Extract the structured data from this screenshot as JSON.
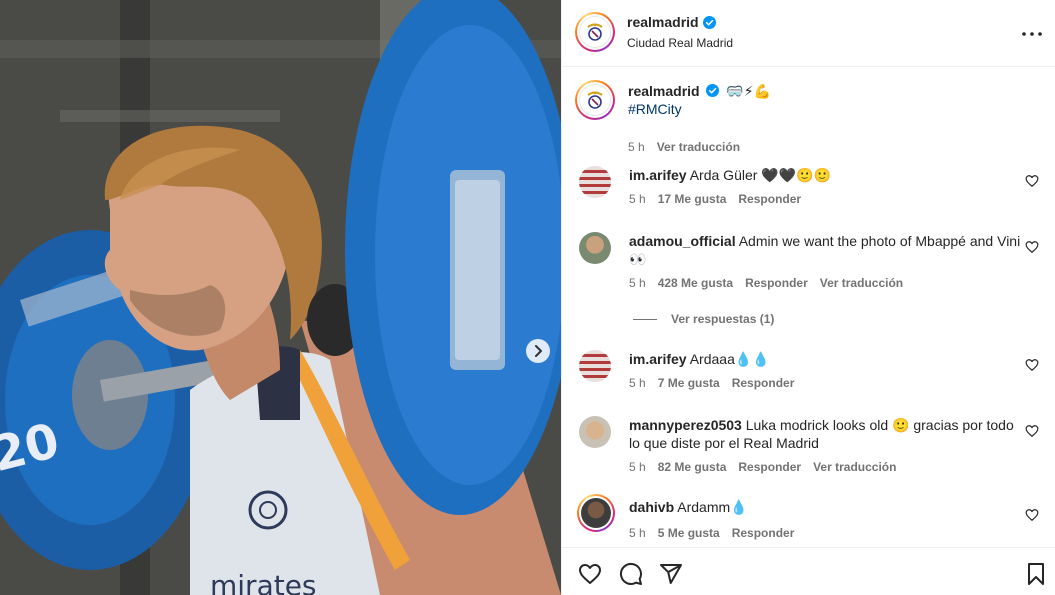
{
  "post": {
    "username": "realmadrid",
    "location": "Ciudad Real Madrid",
    "media": {
      "plate_number": "20",
      "shirt_text": "mirates"
    }
  },
  "caption": {
    "username": "realmadrid",
    "emojis": "🥽⚡💪",
    "hashtag": "#RMCity",
    "time": "5 h",
    "translate": "Ver traducción"
  },
  "comments": [
    {
      "username": "im.arifey",
      "text": "Arda Güler 🖤🖤🙂🙂",
      "time": "5 h",
      "likes": "17 Me gusta",
      "reply": "Responder",
      "translate": ""
    },
    {
      "username": "adamou_official",
      "text": "Admin we want the photo of Mbappé and Vini 👀",
      "time": "5 h",
      "likes": "428 Me gusta",
      "reply": "Responder",
      "translate": "Ver traducción"
    },
    {
      "username": "im.arifey",
      "text": "Ardaaa💧💧",
      "time": "5 h",
      "likes": "7 Me gusta",
      "reply": "Responder",
      "translate": ""
    },
    {
      "username": "mannyperez0503",
      "text": "Luka modrick looks old 🙂 gracias por todo lo que diste por el Real Madrid",
      "time": "5 h",
      "likes": "82 Me gusta",
      "reply": "Responder",
      "translate": "Ver traducción"
    },
    {
      "username": "dahivb",
      "text": "Ardamm💧",
      "time": "5 h",
      "likes": "5 Me gusta",
      "reply": "Responder",
      "translate": ""
    }
  ],
  "replies_label": "Ver respuestas (1)",
  "icons": {
    "verified": "verified-badge-icon",
    "more": "more-options-icon",
    "like": "heart-icon",
    "comment": "comment-icon",
    "share": "share-icon",
    "save": "bookmark-icon",
    "next": "chevron-right-icon"
  },
  "colors": {
    "verified": "#0095f6",
    "hashtag": "#00376b",
    "meta": "#737373",
    "plate_blue": "#1f6fc0"
  }
}
